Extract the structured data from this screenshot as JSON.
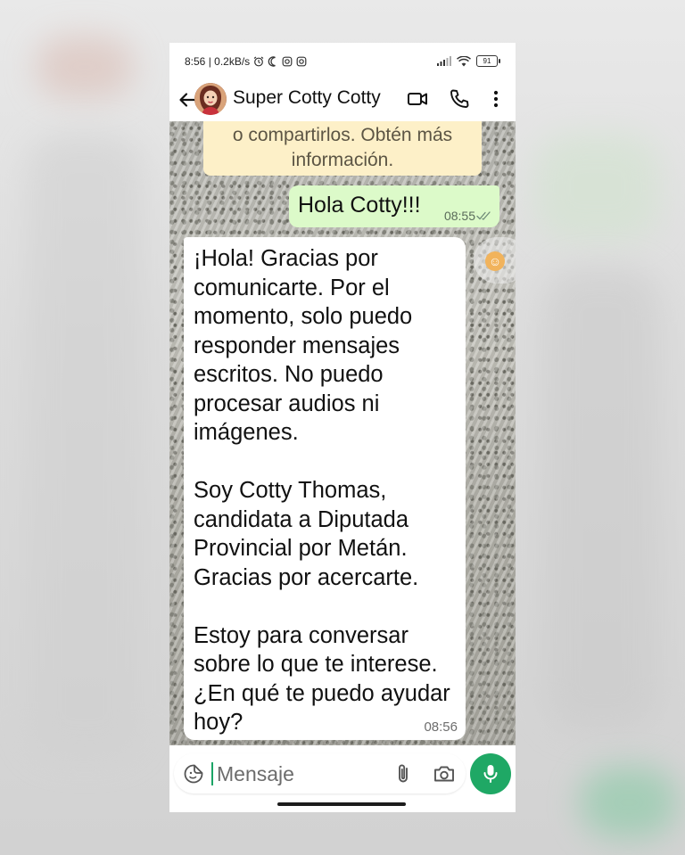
{
  "status_bar": {
    "time_speed": "8:56 | 0.2kB/s",
    "battery": "91",
    "icons": [
      "alarm-icon",
      "moon-icon",
      "instagram-icon",
      "instagram-icon",
      "signal-icon",
      "wifi-icon",
      "battery-icon"
    ]
  },
  "header": {
    "contact_name": "Super Cotty Cotty",
    "icons": [
      "back-arrow-icon",
      "avatar",
      "video-call-icon",
      "phone-call-icon",
      "more-vert-icon"
    ]
  },
  "messages": {
    "system_note": "o compartirlos. Obtén más información.",
    "outgoing": {
      "text": "Hola Cotty!!!",
      "time": "08:55",
      "status": "delivered-double-tick"
    },
    "incoming": {
      "text": "¡Hola! Gracias por comunicarte. Por el momento, solo puedo responder mensajes escritos. No puedo procesar audios ni imágenes.\n\nSoy Cotty Thomas, candidata a Diputada Provincial por Metán. Gracias por acercarte.\n\nEstoy para conversar sobre lo que te interese. ¿En qué te puedo ayudar hoy?",
      "time": "08:56"
    }
  },
  "composer": {
    "placeholder": "Mensaje",
    "icons": [
      "sticker-icon",
      "attach-icon",
      "camera-icon",
      "mic-icon"
    ]
  },
  "colors": {
    "outgoing_bubble": "#dcfac9",
    "system_note_bg": "#fdf0c8",
    "accent_green": "#1fa865"
  }
}
